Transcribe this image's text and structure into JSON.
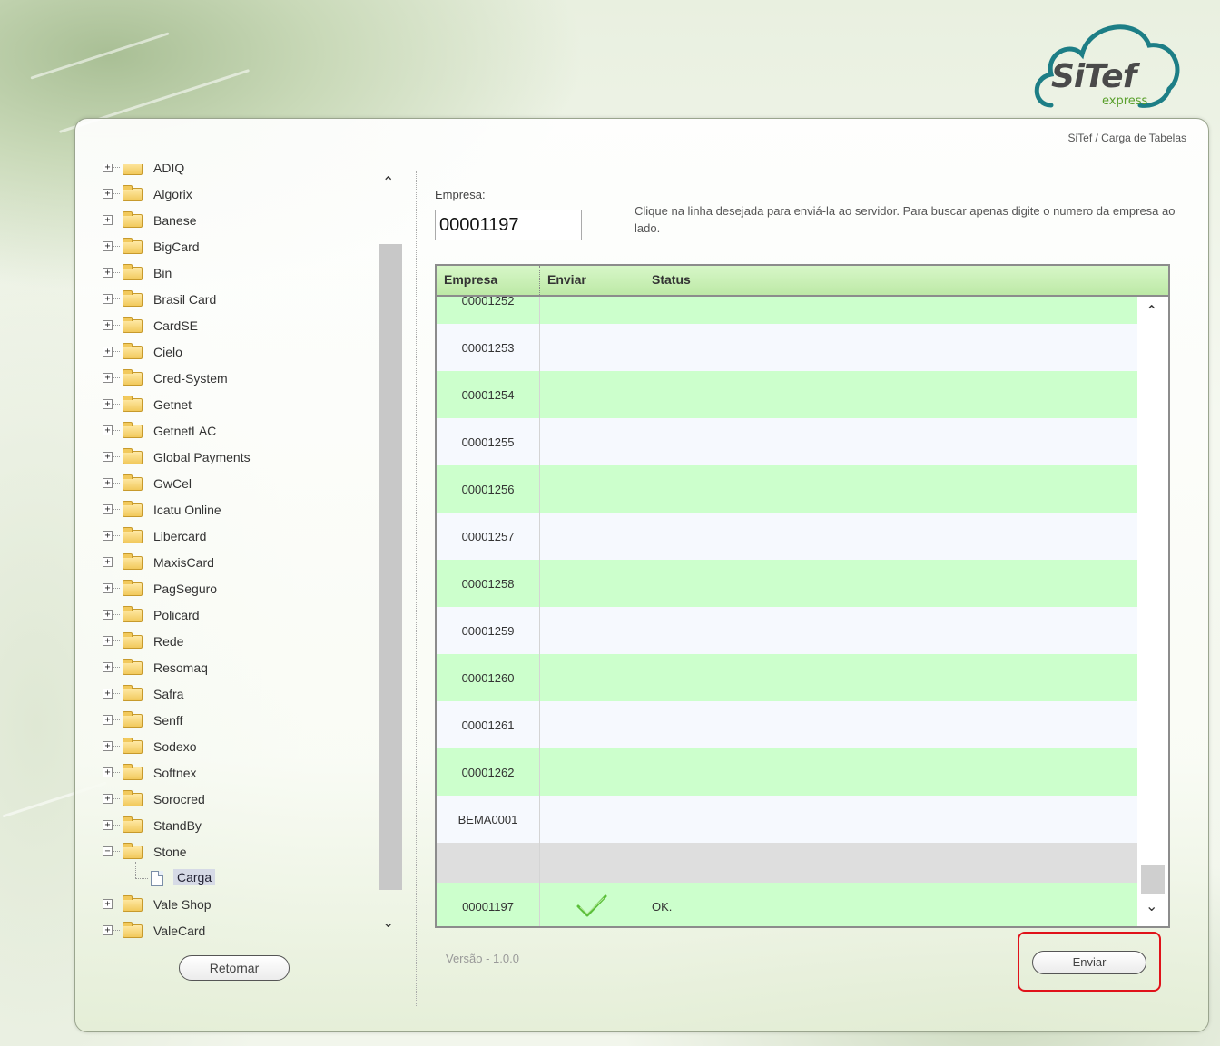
{
  "header": {
    "logo_text": "SiTef",
    "logo_sub": "express",
    "breadcrumb": "SiTef / Carga de Tabelas"
  },
  "tree": {
    "items": [
      {
        "label": "ADIQ",
        "expanded": false
      },
      {
        "label": "Algorix",
        "expanded": false
      },
      {
        "label": "Banese",
        "expanded": false
      },
      {
        "label": "BigCard",
        "expanded": false
      },
      {
        "label": "Bin",
        "expanded": false
      },
      {
        "label": "Brasil Card",
        "expanded": false
      },
      {
        "label": "CardSE",
        "expanded": false
      },
      {
        "label": "Cielo",
        "expanded": false
      },
      {
        "label": "Cred-System",
        "expanded": false
      },
      {
        "label": "Getnet",
        "expanded": false
      },
      {
        "label": "GetnetLAC",
        "expanded": false
      },
      {
        "label": "Global Payments",
        "expanded": false
      },
      {
        "label": "GwCel",
        "expanded": false
      },
      {
        "label": "Icatu Online",
        "expanded": false
      },
      {
        "label": "Libercard",
        "expanded": false
      },
      {
        "label": "MaxisCard",
        "expanded": false
      },
      {
        "label": "PagSeguro",
        "expanded": false
      },
      {
        "label": "Policard",
        "expanded": false
      },
      {
        "label": "Rede",
        "expanded": false
      },
      {
        "label": "Resomaq",
        "expanded": false
      },
      {
        "label": "Safra",
        "expanded": false
      },
      {
        "label": "Senff",
        "expanded": false
      },
      {
        "label": "Sodexo",
        "expanded": false
      },
      {
        "label": "Softnex",
        "expanded": false
      },
      {
        "label": "Sorocred",
        "expanded": false
      },
      {
        "label": "StandBy",
        "expanded": false
      },
      {
        "label": "Stone",
        "expanded": true,
        "children": [
          "Carga"
        ]
      },
      {
        "label": "Vale Shop",
        "expanded": false
      },
      {
        "label": "ValeCard",
        "expanded": false
      }
    ],
    "retornar_label": "Retornar"
  },
  "form": {
    "empresa_label": "Empresa:",
    "empresa_value": "00001197",
    "hint": "Clique na linha desejada para enviá-la ao servidor. Para buscar apenas digite o numero da empresa ao lado."
  },
  "grid": {
    "headers": [
      "Empresa",
      "Enviar",
      "Status"
    ],
    "rows": [
      {
        "empresa": "00001252",
        "enviar": "",
        "status": "",
        "style": "green"
      },
      {
        "empresa": "00001253",
        "enviar": "",
        "status": "",
        "style": "white"
      },
      {
        "empresa": "00001254",
        "enviar": "",
        "status": "",
        "style": "green"
      },
      {
        "empresa": "00001255",
        "enviar": "",
        "status": "",
        "style": "white"
      },
      {
        "empresa": "00001256",
        "enviar": "",
        "status": "",
        "style": "green"
      },
      {
        "empresa": "00001257",
        "enviar": "",
        "status": "",
        "style": "white"
      },
      {
        "empresa": "00001258",
        "enviar": "",
        "status": "",
        "style": "green"
      },
      {
        "empresa": "00001259",
        "enviar": "",
        "status": "",
        "style": "white"
      },
      {
        "empresa": "00001260",
        "enviar": "",
        "status": "",
        "style": "green"
      },
      {
        "empresa": "00001261",
        "enviar": "",
        "status": "",
        "style": "white"
      },
      {
        "empresa": "00001262",
        "enviar": "",
        "status": "",
        "style": "green"
      },
      {
        "empresa": "BEMA0001",
        "enviar": "",
        "status": "",
        "style": "white"
      },
      {
        "empresa": "",
        "enviar": "",
        "status": "",
        "style": "gray"
      },
      {
        "empresa": "00001197",
        "enviar": "check",
        "status": "OK.",
        "style": "green"
      }
    ]
  },
  "footer": {
    "versao": "Versão  -  1.0.0",
    "enviar_label": "Enviar"
  },
  "colors": {
    "row_green": "#ccffcc",
    "header_green": "#bde9a6",
    "check_green": "#5bbf3a",
    "highlight_red": "#e0121a"
  }
}
